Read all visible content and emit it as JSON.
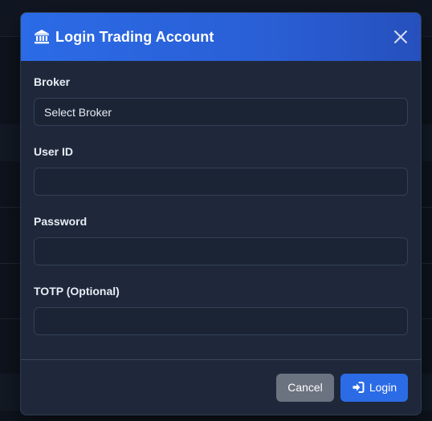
{
  "modal": {
    "title": "Login Trading Account",
    "title_icon": "bank-icon",
    "close_icon": "close-icon"
  },
  "fields": {
    "broker": {
      "label": "Broker",
      "value": "Select Broker"
    },
    "user_id": {
      "label": "User ID",
      "placeholder": ""
    },
    "password": {
      "label": "Password",
      "placeholder": ""
    },
    "totp": {
      "label": "TOTP (Optional)",
      "placeholder": ""
    }
  },
  "footer": {
    "cancel_label": "Cancel",
    "login_label": "Login",
    "login_icon": "sign-in-icon"
  },
  "colors": {
    "primary": "#2b6be6",
    "modal_bg": "#1e283a",
    "secondary_button": "#6b7380"
  }
}
